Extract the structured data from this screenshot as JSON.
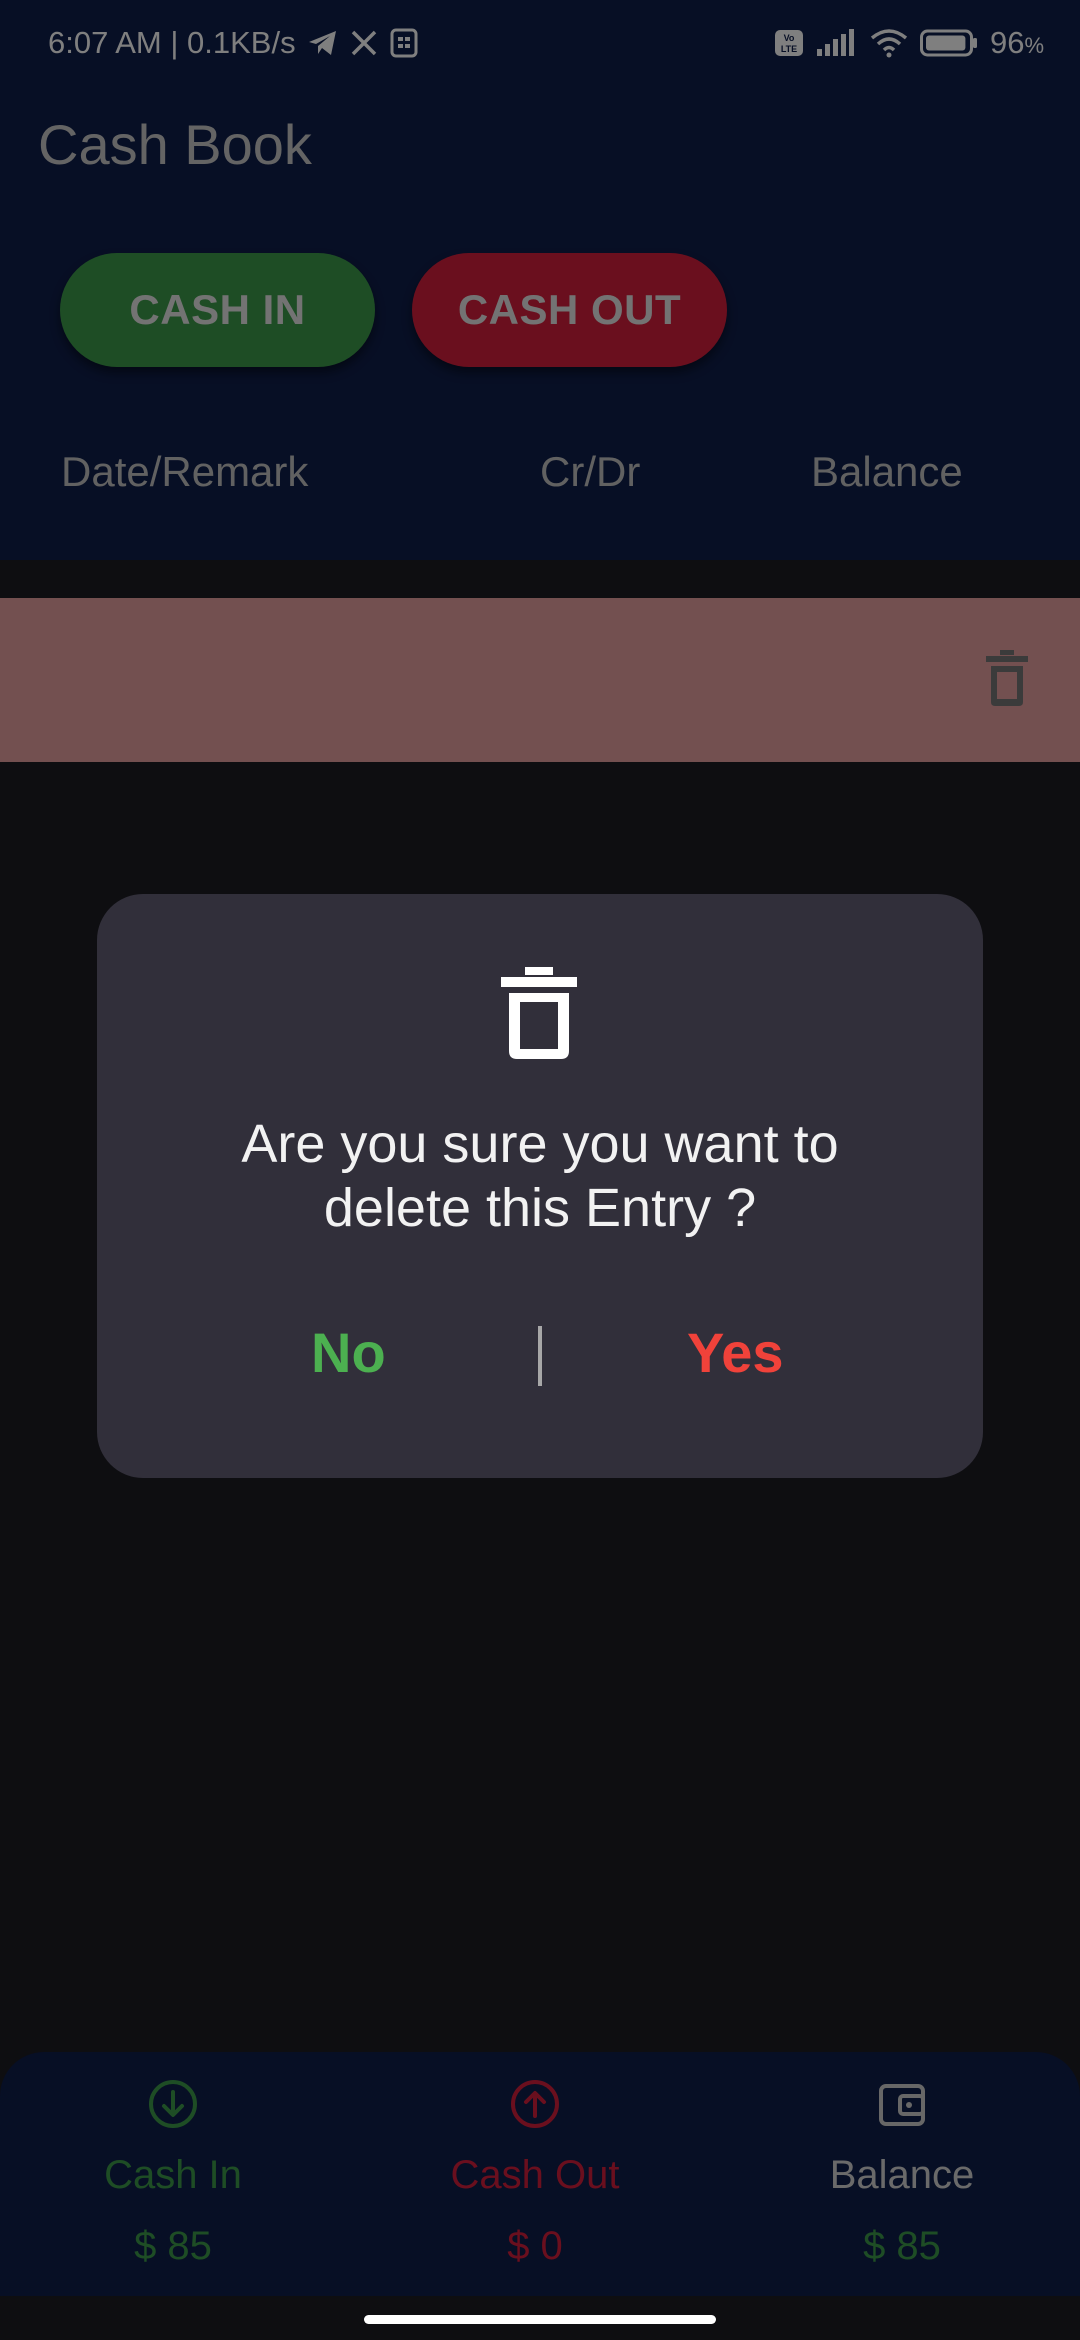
{
  "status_bar": {
    "time": "6:07 AM | 0.1KB/s",
    "battery_text": "96",
    "battery_unit": "%",
    "icons": [
      "telegram-icon",
      "x-icon",
      "notification-icon",
      "volte-icon",
      "signal-icon",
      "wifi-icon",
      "battery-icon"
    ],
    "battery_level": 0.96
  },
  "header": {
    "title": "Cash Book",
    "cash_in_label": "CASH IN",
    "cash_out_label": "CASH OUT"
  },
  "columns": [
    "Date/Remark",
    "Cr/Dr",
    "Balance"
  ],
  "entry_row": {
    "action_icon": "trash-icon"
  },
  "bottom_nav": {
    "items": [
      {
        "label": "Cash In",
        "value": "$ 85",
        "icon": "arrow-down-circle-icon",
        "color": "#3d9a4a"
      },
      {
        "label": "Cash Out",
        "value": "$ 0",
        "icon": "arrow-up-circle-icon",
        "color": "#d51f3d"
      },
      {
        "label": "Balance",
        "value": "$ 85",
        "icon": "wallet-icon",
        "color": "#d5d5d5"
      }
    ]
  },
  "dialog": {
    "icon": "trash-icon",
    "message_line1": "Are you sure you want to",
    "message_line2": "delete this Entry ?",
    "no_label": "No",
    "yes_label": "Yes"
  },
  "colors": {
    "header_bg": "#0f1e4a",
    "cash_in_green": "#3d9a4a",
    "cash_out_red": "#d51f3d",
    "dialog_bg": "#312f3a",
    "no_green": "#4cb050",
    "yes_red": "#f0423a",
    "entry_row_bg": "#e6a1a1"
  }
}
